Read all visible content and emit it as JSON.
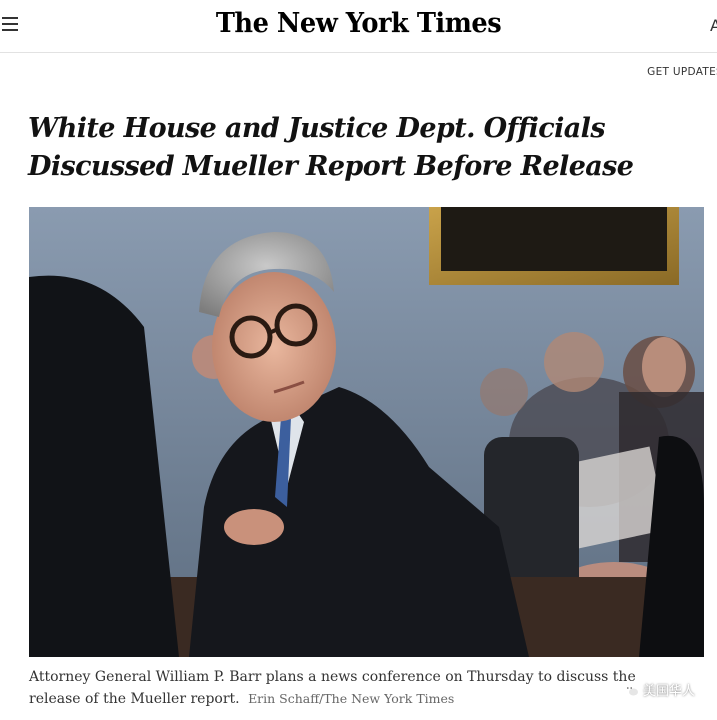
{
  "header": {
    "menu_icon": "hamburger-menu-icon",
    "masthead": "The New York Times",
    "edge_glyph": "A",
    "get_updates": "GET UPDATES"
  },
  "article": {
    "headline": "White House and Justice Dept. Officials Discussed Mueller Report Before Release",
    "photo": {
      "caption": "Attorney General William P. Barr plans a news conference on Thursday to discuss the release of the Mueller report.",
      "credit": "Erin Schaff/The New York Times"
    }
  },
  "watermark": {
    "text": "美国华人",
    "icon": "wechat-icon"
  },
  "colors": {
    "text": "#121212",
    "caption": "#333333",
    "credit": "#666666",
    "divider": "#e2e2e2"
  }
}
